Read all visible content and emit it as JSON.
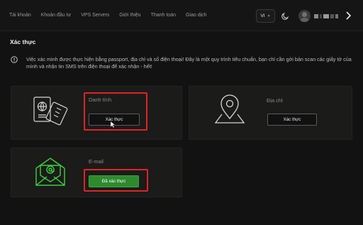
{
  "nav": {
    "items": [
      "Tài khoản",
      "Khoản đầu tư",
      "VPS Servers",
      "Giới thiệu",
      "Thanh toán",
      "Giao dịch"
    ]
  },
  "header": {
    "language": "VI"
  },
  "page": {
    "title": "Xác thực",
    "notice": "Việc xác minh được thực hiện bằng passport, địa chỉ và số điện thoại! Đây là một quy trình tiêu chuẩn, bạn chỉ cần gởi bản scan các giấy tờ của mình và nhận tin SMS trên điện thoại để xác nhận - hết!"
  },
  "cards": {
    "identity": {
      "label": "Danh tính",
      "button": "Xác thực"
    },
    "address": {
      "label": "Địa chỉ",
      "button": "Xác thực"
    },
    "email": {
      "label": "E-mail",
      "button": "Đã xác thực"
    }
  },
  "colors": {
    "background": "#121212",
    "card": "#1b1b1a",
    "highlight": "#e02424",
    "verified": "#2f8a2f",
    "icon_green": "#3ccf3c"
  },
  "icons": [
    "passport-icon",
    "location-pin-icon",
    "email-envelope-icon",
    "info-icon",
    "moon-icon",
    "chevron-right-icon"
  ]
}
